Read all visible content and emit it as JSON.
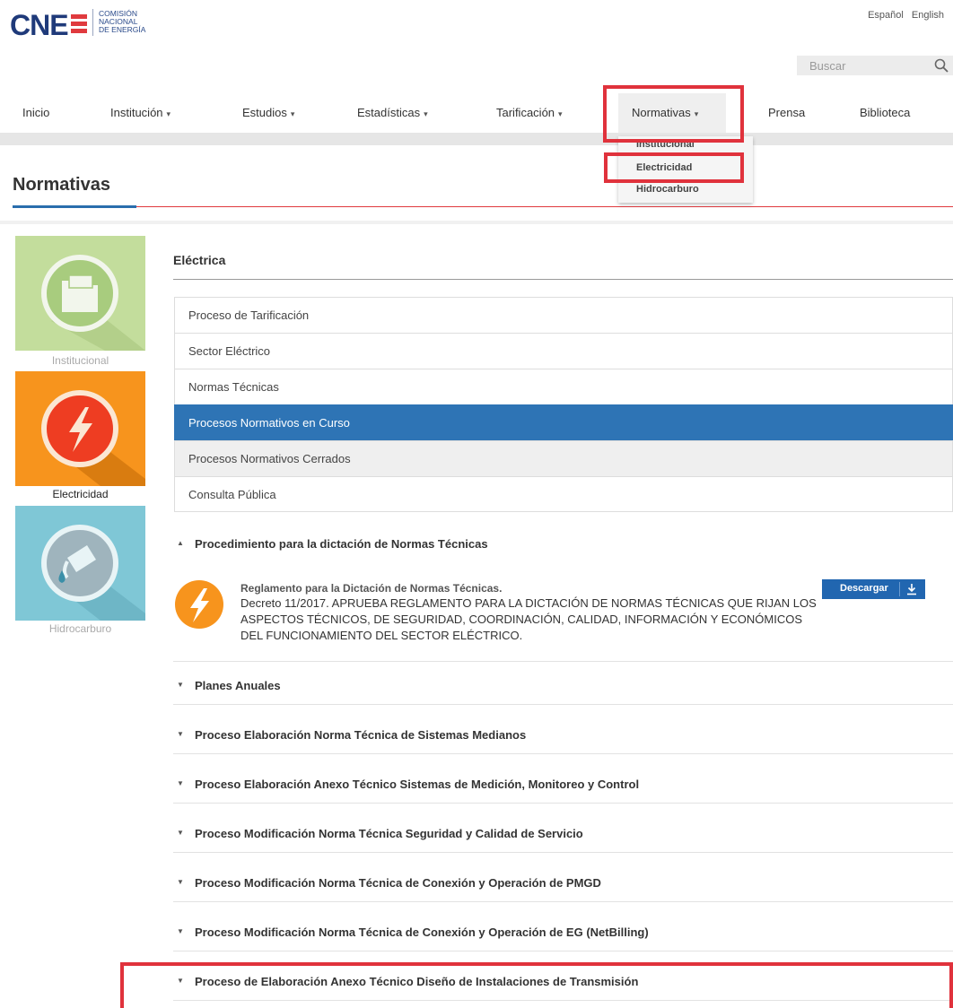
{
  "header": {
    "logo": {
      "wordmark": "CNE",
      "line1": "COMISIÓN",
      "line2": "NACIONAL",
      "line3": "DE ENERGÍA"
    },
    "languages": [
      "Español",
      "English"
    ],
    "search": {
      "placeholder": "Buscar",
      "icon": "search-icon"
    }
  },
  "nav": {
    "items": [
      {
        "label": "Inicio",
        "has_caret": false
      },
      {
        "label": "Institución",
        "has_caret": true
      },
      {
        "label": "Estudios",
        "has_caret": true
      },
      {
        "label": "Estadísticas",
        "has_caret": true
      },
      {
        "label": "Tarificación",
        "has_caret": true
      },
      {
        "label": "Normativas",
        "has_caret": true,
        "active": true
      },
      {
        "label": "Prensa",
        "has_caret": false
      },
      {
        "label": "Biblioteca",
        "has_caret": false
      }
    ],
    "caret": "▾",
    "dropdown": [
      "Institucional",
      "Electricidad",
      "Hidrocarburo"
    ]
  },
  "page": {
    "title": "Normativas"
  },
  "sidebar": {
    "categories": [
      {
        "label": "Institucional",
        "icon": "folder-icon",
        "color": "#c3dd9c"
      },
      {
        "label": "Electricidad",
        "icon": "lightning-icon",
        "color": "#f7941d",
        "selected": true
      },
      {
        "label": "Hidrocarburo",
        "icon": "fuel-nozzle-icon",
        "color": "#7fc7d6"
      }
    ]
  },
  "content": {
    "section_heading": "Eléctrica",
    "sub_menu": [
      "Proceso de Tarificación",
      "Sector Eléctrico",
      "Normas Técnicas",
      "Procesos Normativos en Curso",
      "Procesos Normativos Cerrados",
      "Consulta Pública"
    ],
    "sub_menu_active": "Procesos Normativos en Curso",
    "accordion": [
      {
        "label": "Procedimiento para la dictación de Normas Técnicas",
        "expanded": true,
        "arrow": "▲"
      },
      {
        "label": "Planes Anuales",
        "expanded": false,
        "arrow": "▼"
      },
      {
        "label": "Proceso Elaboración Norma Técnica de Sistemas Medianos",
        "expanded": false,
        "arrow": "▼"
      },
      {
        "label": "Proceso Elaboración Anexo Técnico Sistemas de Medición, Monitoreo y Control",
        "expanded": false,
        "arrow": "▼"
      },
      {
        "label": "Proceso Modificación Norma Técnica Seguridad y Calidad de Servicio",
        "expanded": false,
        "arrow": "▼"
      },
      {
        "label": "Proceso Modificación Norma Técnica de Conexión y Operación de PMGD",
        "expanded": false,
        "arrow": "▼"
      },
      {
        "label": "Proceso Modificación Norma Técnica de Conexión y Operación de EG (NetBilling)",
        "expanded": false,
        "arrow": "▼"
      },
      {
        "label": "Proceso de Elaboración Anexo Técnico Diseño de Instalaciones de Transmisión",
        "expanded": false,
        "arrow": "▼"
      }
    ],
    "document": {
      "title": "Reglamento para la Dictación de Normas Técnicas.",
      "description": "Decreto 11/2017. APRUEBA REGLAMENTO PARA LA DICTACIÓN DE NORMAS TÉCNICAS QUE RIJAN LOS ASPECTOS TÉCNICOS, DE SEGURIDAD, COORDINACIÓN, CALIDAD, INFORMACIÓN Y ECONÓMICOS DEL FUNCIONAMIENTO DEL SECTOR ELÉCTRICO.",
      "download_label": "Descargar",
      "icon": "download-icon"
    }
  },
  "colors": {
    "accent_blue": "#2e74b5",
    "highlight_red": "#e0323c",
    "title_red_line": "#e03a3e"
  }
}
